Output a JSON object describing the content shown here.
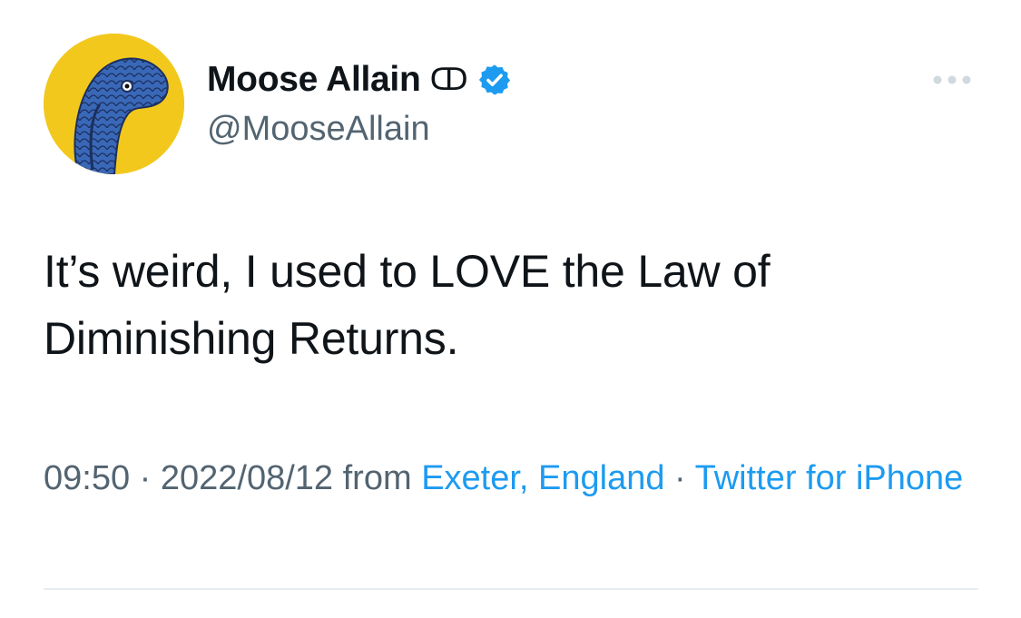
{
  "author": {
    "display_name": "Moose Allain",
    "name_glyphs": "ↀ",
    "handle": "@MooseAllain",
    "verified": true,
    "avatar_icon": "blue-bird-on-yellow-avatar"
  },
  "tweet": {
    "text": "It’s weird, I used to LOVE the Law of Diminishing Returns."
  },
  "meta": {
    "time": "09:50",
    "separator_1": " · ",
    "date": "2022/08/12",
    "from_label": " from ",
    "location": "Exeter, England",
    "separator_2": " · ",
    "source": "Twitter for iPhone"
  },
  "icons": {
    "more": "more-horizontal-icon",
    "verified": "verified-badge-icon"
  },
  "colors": {
    "accent": "#1d9bf0",
    "secondary_text": "#536471",
    "primary_text": "#0f1419",
    "avatar_bg": "#f2c81d",
    "avatar_bird": "#3a68b8"
  }
}
